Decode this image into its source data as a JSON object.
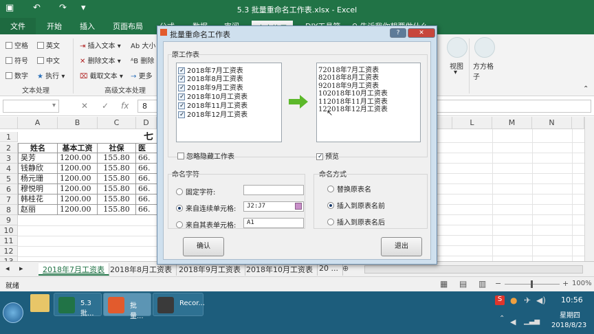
{
  "window": {
    "title": "5.3 批量重命名工作表.xlsx - Excel"
  },
  "tabs": [
    "文件",
    "开始",
    "插入",
    "页面布局",
    "公式",
    "数据",
    "审阅",
    "视图",
    "方方格子",
    "DIY工具箱"
  ],
  "active_tab": "方方格子",
  "search_hint": "告诉我你想要做什么",
  "ribbon": {
    "text_group": [
      "空格",
      "英文",
      "符号",
      "中文",
      "数字",
      "执行"
    ],
    "adv_group": [
      "插入文本",
      "删除文本",
      "截取文本",
      "大小",
      "删除",
      "更多"
    ],
    "group_text": "文本处理",
    "group_adv": "高级文本处理",
    "view_label": "视图",
    "ffgz_label": "方方格子"
  },
  "formula_bar": {
    "namebox": "",
    "content": "8"
  },
  "columns": [
    "A",
    "B",
    "C",
    "D",
    "L",
    "M",
    "N"
  ],
  "rows": [
    "1",
    "2",
    "3",
    "4",
    "5",
    "6",
    "7",
    "8",
    "9",
    "10",
    "11",
    "12",
    "13"
  ],
  "sheet": {
    "title_char": "七",
    "headers": [
      "姓名",
      "基本工资",
      "社保",
      "医"
    ],
    "data": [
      [
        "吴芳",
        "1200.00",
        "155.80",
        "66."
      ],
      [
        "钱静欣",
        "1200.00",
        "155.80",
        "66."
      ],
      [
        "杨元珊",
        "1200.00",
        "155.80",
        "66."
      ],
      [
        "穆悦明",
        "1200.00",
        "155.80",
        "66."
      ],
      [
        "韩桂花",
        "1200.00",
        "155.80",
        "66."
      ],
      [
        "赵丽",
        "1200.00",
        "155.80",
        "66."
      ]
    ]
  },
  "sheet_tabs": [
    "2018年7月工资表",
    "2018年8月工资表",
    "2018年9月工资表",
    "2018年10月工资表",
    "20 ..."
  ],
  "status": {
    "ready": "就绪",
    "zoom": "100%"
  },
  "dialog": {
    "title": "批量重命名工作表",
    "sec_original": "原工作表",
    "original": [
      "2018年7月工资表",
      "2018年8月工资表",
      "2018年9月工资表",
      "2018年10月工资表",
      "2018年11月工资表",
      "2018年12月工资表"
    ],
    "preview_list": [
      "72018年7月工资表",
      "82018年8月工资表",
      "92018年9月工资表",
      "102018年10月工资表",
      "112018年11月工资表",
      "122018年12月工资表"
    ],
    "ignore_hidden": "忽略隐藏工作表",
    "preview": "预览",
    "sec_naming": "命名字符",
    "fixed_chars": "固定字符:",
    "from_cells": "来自连续单元格:",
    "from_cells_value": "J2:J7",
    "from_other": "来自其表单元格:",
    "from_other_value": "A1",
    "sec_mode": "命名方式",
    "mode_replace": "替换原表名",
    "mode_before": "插入到原表名前",
    "mode_after": "插入到原表名后",
    "ok": "确认",
    "exit": "退出"
  },
  "taskbar": {
    "items": [
      "5.3 批...",
      "批量...",
      "Recor..."
    ],
    "time": "10:56",
    "weekday": "星期四",
    "date": "2018/8/23"
  }
}
